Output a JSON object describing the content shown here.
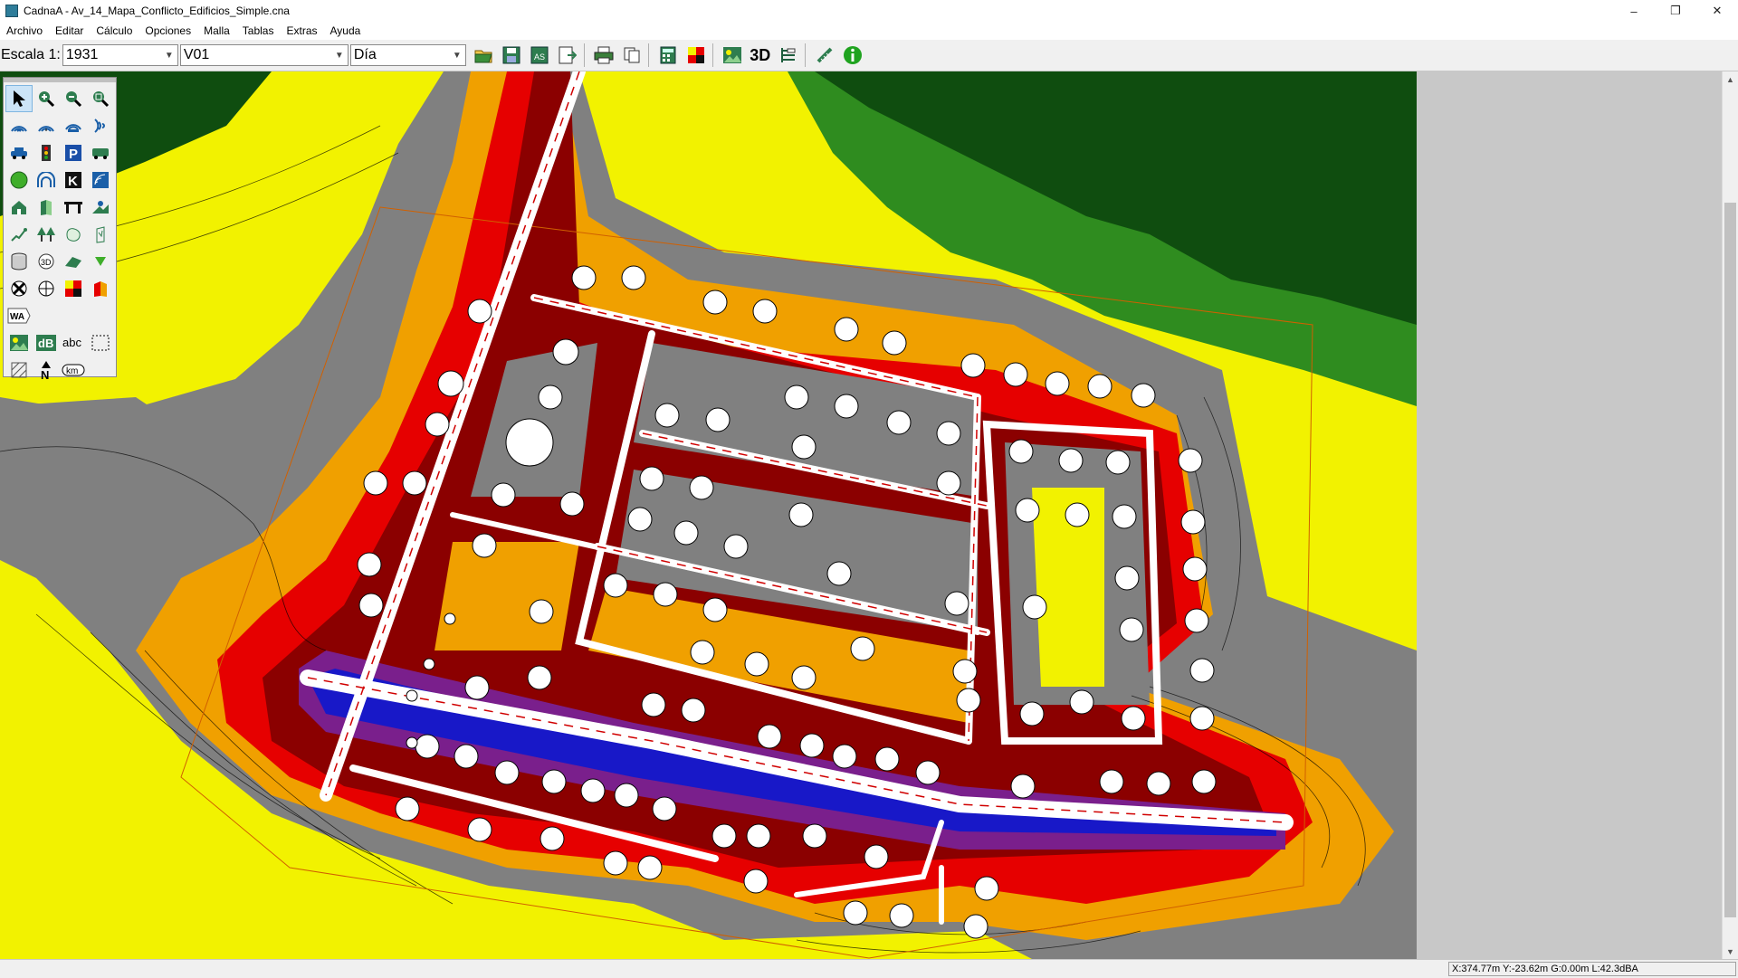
{
  "window": {
    "title": "CadnaA - Av_14_Mapa_Conflicto_Edificios_Simple.cna",
    "minimize": "–",
    "restore": "❐",
    "close": "✕"
  },
  "menu": [
    "Archivo",
    "Editar",
    "Cálculo",
    "Opciones",
    "Malla",
    "Tablas",
    "Extras",
    "Ayuda"
  ],
  "toolbar": {
    "scale_label": "Escala 1:",
    "scale_value": "1931",
    "variant_value": "V01",
    "period_value": "Día",
    "btn_3d": "3D"
  },
  "palette": {
    "wa_label": "WA",
    "db_label": "dB",
    "abc_label": "abc",
    "k_label": "K",
    "p_label": "P",
    "km_label": "km",
    "n_label": "N"
  },
  "status": {
    "coordinates": "X:374.77m Y:-23.62m G:0.00m L:42.3dBA"
  },
  "colors": {
    "dark_green": "#0f4d0f",
    "green": "#2f8c1f",
    "yellow": "#f2f200",
    "gray": "#808080",
    "orange": "#f0a000",
    "red": "#e60000",
    "dark_red": "#8b0000",
    "purple": "#7a1f8c",
    "blue": "#1818c8"
  }
}
